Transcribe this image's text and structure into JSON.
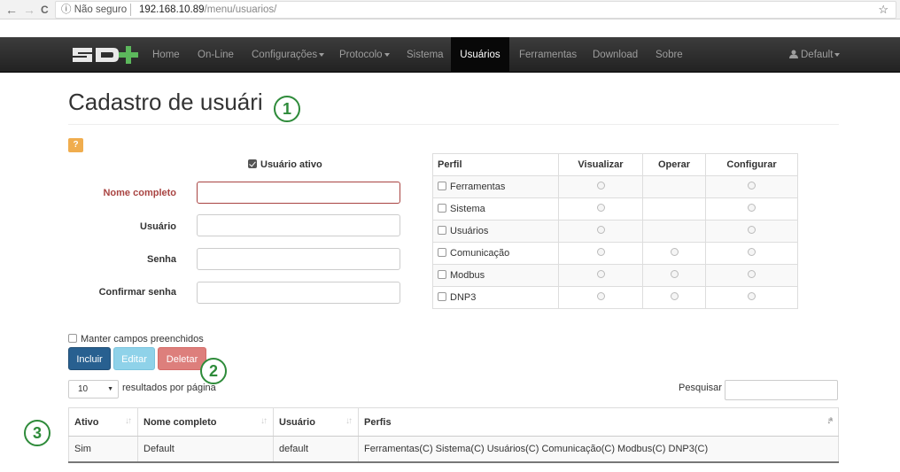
{
  "browser": {
    "back": "←",
    "forward": "→",
    "reload": "C",
    "security": "ⓘ Não seguro",
    "host": "192.168.10.89",
    "path": "/menu/usuarios/",
    "bookmark": "☆"
  },
  "navbar": {
    "brand": "SD+",
    "items": [
      {
        "label": "Home"
      },
      {
        "label": "On-Line"
      },
      {
        "label": "Configurações"
      },
      {
        "label": "Protocolo"
      },
      {
        "label": "Sistema"
      },
      {
        "label": "Usuários"
      },
      {
        "label": "Ferramentas"
      },
      {
        "label": "Download"
      },
      {
        "label": "Sobre"
      }
    ],
    "user": "Default"
  },
  "page": {
    "title": "Cadastro de usuári",
    "help": "?",
    "badges": [
      "1",
      "2",
      "3"
    ]
  },
  "form": {
    "active_label": "Usuário ativo",
    "active_checked": true,
    "fields": [
      {
        "label": "Nome completo",
        "value": "",
        "error": true
      },
      {
        "label": "Usuário",
        "value": ""
      },
      {
        "label": "Senha",
        "value": ""
      },
      {
        "label": "Confirmar senha",
        "value": ""
      }
    ],
    "keep_fields": "Manter campos preenchidos"
  },
  "permissions": {
    "headers": [
      "Perfil",
      "Visualizar",
      "Operar",
      "Configurar"
    ],
    "rows": [
      {
        "name": "Ferramentas",
        "view": true,
        "operate": false,
        "configure": true
      },
      {
        "name": "Sistema",
        "view": true,
        "operate": false,
        "configure": true
      },
      {
        "name": "Usuários",
        "view": true,
        "operate": false,
        "configure": true
      },
      {
        "name": "Comunicação",
        "view": true,
        "operate": true,
        "configure": true
      },
      {
        "name": "Modbus",
        "view": true,
        "operate": true,
        "configure": true
      },
      {
        "name": "DNP3",
        "view": true,
        "operate": true,
        "configure": true
      }
    ]
  },
  "actions": {
    "include": "Incluir",
    "edit": "Editar",
    "delete": "Deletar"
  },
  "list": {
    "page_length": "10",
    "page_length_suffix": "resultados por página",
    "search_label": "Pesquisar",
    "search_value": "",
    "headers": [
      "Ativo",
      "Nome completo",
      "Usuário",
      "Perfis"
    ],
    "rows": [
      [
        "Sim",
        "Default",
        "default",
        "Ferramentas(C) Sistema(C) Usuários(C) Comunicação(C) Modbus(C) DNP3(C)"
      ]
    ]
  }
}
